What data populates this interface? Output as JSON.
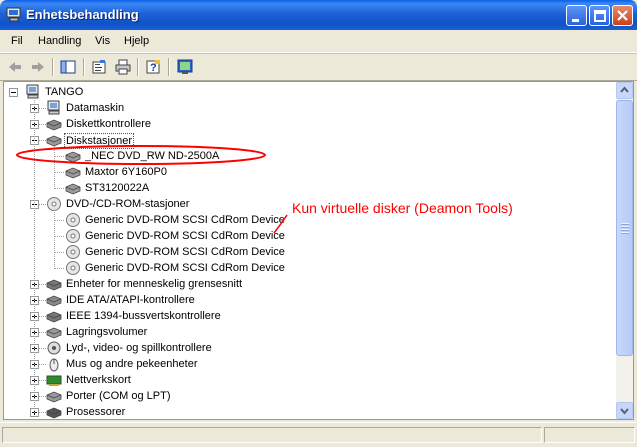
{
  "window": {
    "title": "Enhetsbehandling"
  },
  "menu": [
    "Fil",
    "Handling",
    "Vis",
    "Hjelp"
  ],
  "toolbar": [
    "back-arrow-icon",
    "forward-arrow-icon",
    "show-hide-tree-icon",
    "properties-icon",
    "print-icon",
    "help-icon",
    "scan-hardware-icon"
  ],
  "tree": {
    "root": "TANGO",
    "items": [
      {
        "label": "Datamaskin",
        "icon": "computer-icon",
        "expanded": false
      },
      {
        "label": "Diskettkontrollere",
        "icon": "floppy-controller-icon",
        "expanded": false
      },
      {
        "label": "Diskstasjoner",
        "icon": "disk-drive-icon",
        "expanded": true,
        "selected": true,
        "children": [
          "_NEC DVD_RW ND-2500A",
          "Maxtor 6Y160P0",
          "ST3120022A"
        ]
      },
      {
        "label": "DVD-/CD-ROM-stasjoner",
        "icon": "cdrom-icon",
        "expanded": true,
        "children": [
          "Generic DVD-ROM SCSI CdRom Device",
          "Generic DVD-ROM SCSI CdRom Device",
          "Generic DVD-ROM SCSI CdRom Device",
          "Generic DVD-ROM SCSI CdRom Device"
        ]
      },
      {
        "label": "Enheter for menneskelig grensesnitt",
        "icon": "hid-icon",
        "expanded": false
      },
      {
        "label": "IDE ATA/ATAPI-kontrollere",
        "icon": "ide-controller-icon",
        "expanded": false
      },
      {
        "label": "IEEE 1394-bussvertskontrollere",
        "icon": "firewire-icon",
        "expanded": false
      },
      {
        "label": "Lagringsvolumer",
        "icon": "storage-volume-icon",
        "expanded": false
      },
      {
        "label": "Lyd-, video- og spillkontrollere",
        "icon": "sound-icon",
        "expanded": false
      },
      {
        "label": "Mus og andre pekeenheter",
        "icon": "mouse-icon",
        "expanded": false
      },
      {
        "label": "Nettverkskort",
        "icon": "network-card-icon",
        "expanded": false
      },
      {
        "label": "Porter (COM og LPT)",
        "icon": "port-icon",
        "expanded": false
      },
      {
        "label": "Prosessorer",
        "icon": "processor-icon",
        "expanded": false
      }
    ]
  },
  "annotation": {
    "text": "Kun virtuelle disker (Deamon Tools)",
    "color": "#ff0000"
  },
  "colors": {
    "titlebar": "#0f52c8",
    "window_bg": "#ece9d8",
    "annotation": "#ff0000"
  }
}
